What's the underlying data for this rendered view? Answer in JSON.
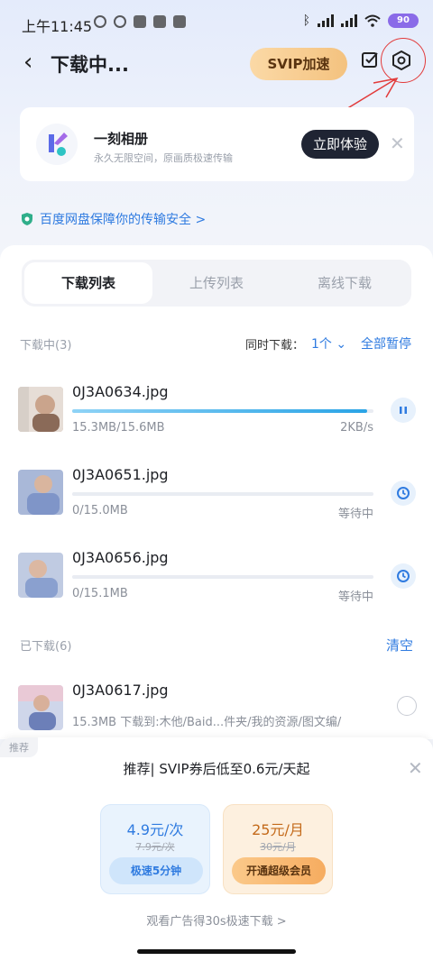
{
  "status": {
    "time": "上午11:45",
    "battery": "90"
  },
  "header": {
    "title": "下载中...",
    "svip_label": "SVIP加速"
  },
  "ad": {
    "title": "一刻相册",
    "subtitle": "永久无限空间，原画质极速传输",
    "cta": "立即体验",
    "close": "✕"
  },
  "safety_text": "百度网盘保障你的传输安全 >",
  "tabs": [
    {
      "label": "下载列表",
      "active": true
    },
    {
      "label": "上传列表",
      "active": false
    },
    {
      "label": "离线下载",
      "active": false
    }
  ],
  "downloading": {
    "label": "下载中(3)",
    "simultaneous_label": "同时下载：",
    "simultaneous_value": "1个 ⌄",
    "pause_all": "全部暂停",
    "items": [
      {
        "name": "0J3A0634.jpg",
        "size": "15.3MB/15.6MB",
        "status": "2KB/s",
        "progress": 0.98,
        "action": "pause"
      },
      {
        "name": "0J3A0651.jpg",
        "size": "0/15.0MB",
        "status": "等待中",
        "progress": 0,
        "action": "waiting"
      },
      {
        "name": "0J3A0656.jpg",
        "size": "0/15.1MB",
        "status": "等待中",
        "progress": 0,
        "action": "waiting"
      }
    ]
  },
  "downloaded": {
    "label": "已下载(6)",
    "clear": "清空",
    "items": [
      {
        "name": "0J3A0617.jpg",
        "detail": "15.3MB  下载到:木他/Baid...件夹/我的资源/图文编/"
      }
    ]
  },
  "sheet": {
    "tag": "推荐",
    "title": "推荐| SVIP券后低至0.6元/天起",
    "close": "✕",
    "offers": [
      {
        "price": "4.9元/次",
        "old": "7.9元/次",
        "button": "极速5分钟"
      },
      {
        "price": "25元/月",
        "old": "30元/月",
        "button": "开通超级会员"
      }
    ],
    "watch_ad": "观看广告得30s极速下载 >"
  },
  "colors": {
    "accent": "#2f7be0",
    "annotation": "#e23a3a"
  }
}
